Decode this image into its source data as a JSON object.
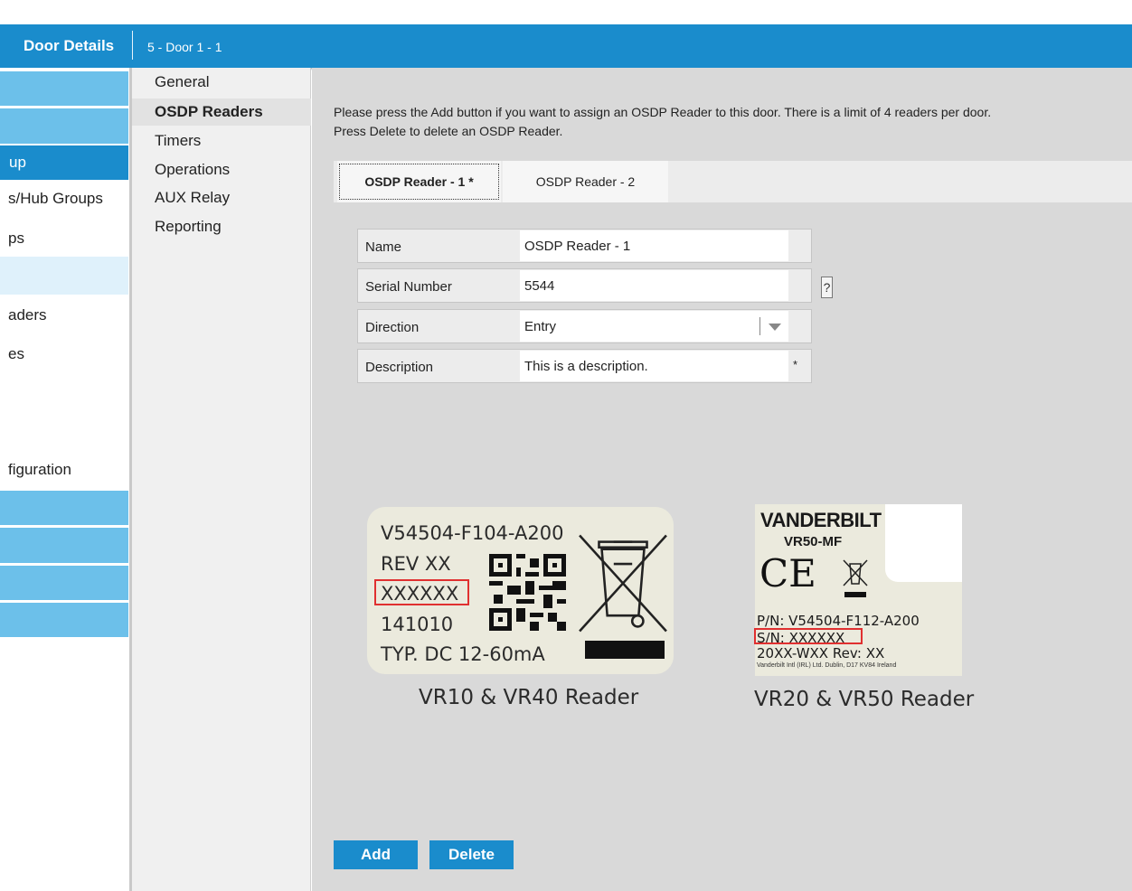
{
  "header": {
    "title": "Door Details",
    "door_label": "5  -  Door 1 - 1"
  },
  "sidebar": {
    "items": [
      {
        "label": "up"
      },
      {
        "label": "s/Hub Groups"
      },
      {
        "label": "ps"
      },
      {
        "label": "aders"
      },
      {
        "label": "es"
      },
      {
        "label": "figuration"
      }
    ]
  },
  "menu": {
    "items": [
      "General",
      "OSDP Readers",
      "Timers",
      "Operations",
      "AUX Relay",
      "Reporting"
    ],
    "selected": "OSDP Readers"
  },
  "main": {
    "instructions_line1": "Please press the Add button if you want to assign an OSDP Reader to this door. There is a limit of 4 readers per door.",
    "instructions_line2": "Press Delete to delete an OSDP Reader.",
    "tabs": [
      {
        "label": "OSDP Reader - 1  *",
        "active": true
      },
      {
        "label": "OSDP Reader - 2",
        "active": false
      }
    ],
    "form": {
      "name_label": "Name",
      "name_value": "OSDP Reader - 1",
      "serial_label": "Serial Number",
      "serial_value": "5544",
      "direction_label": "Direction",
      "direction_value": "Entry",
      "description_label": "Description",
      "description_value": "This is a description.",
      "required_mark": "*",
      "help_label": "?"
    },
    "reader1": {
      "part": "V54504-F104-A200",
      "rev": "REV XX",
      "serial": "XXXXXX",
      "date": "141010",
      "typ": "TYP. DC 12-60mA",
      "caption": "VR10 & VR40 Reader"
    },
    "reader2": {
      "brand": "VANDERBILT",
      "model": "VR50-MF",
      "ce": "CE",
      "pn": "P/N: V54504-F112-A200",
      "sn": "S/N: XXXXXX",
      "rev": "20XX-WXX   Rev: XX",
      "address": "Vanderbilt Intl (IRL) Ltd. Dublin, D17 KV84 Ireland",
      "caption": "VR20 & VR50 Reader"
    },
    "buttons": {
      "add": "Add",
      "delete": "Delete"
    }
  },
  "colors": {
    "accent": "#1a8ccc",
    "sidebar_block": "#6cc0ea",
    "highlight": "#e03030"
  }
}
